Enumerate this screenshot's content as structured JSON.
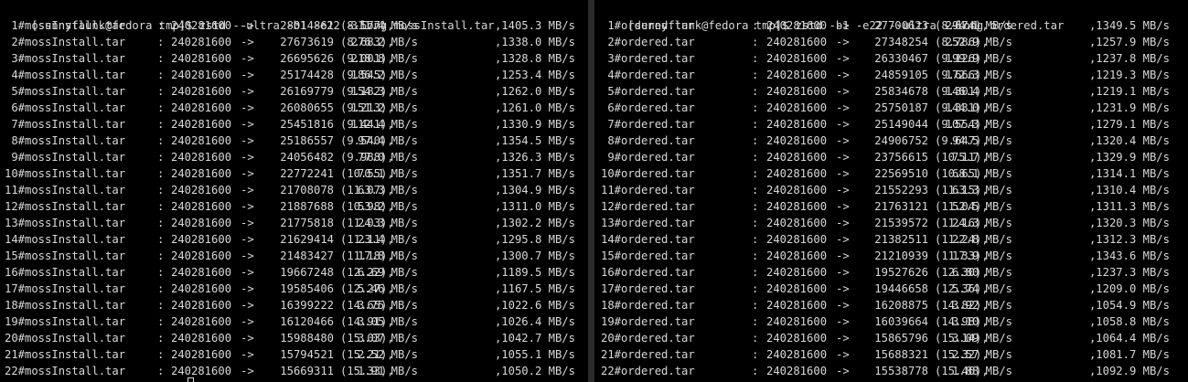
{
  "left": {
    "prompt": "[sunnyflunk@fedora tmp]$ ",
    "command": "zstd --ultra -b1 -e22 --long mossInstall.tar",
    "rows": [
      {
        "name": " 1#mossInstall.tar",
        "sep": ":",
        "in": "240281600",
        "arrow": "->",
        "out": "28014861",
        "ratio": "(8.577),",
        "comp": "311.4 MB/s",
        "decomp": ",1405.3 MB/s"
      },
      {
        "name": " 2#mossInstall.tar",
        "sep": ":",
        "in": "240281600",
        "arrow": "->",
        "out": "27673619",
        "ratio": "(8.683),",
        "comp": "276.2 MB/s",
        "decomp": ",1338.0 MB/s"
      },
      {
        "name": " 3#mossInstall.tar",
        "sep": ":",
        "in": "240281600",
        "arrow": "->",
        "out": "26695626",
        "ratio": "(9.001),",
        "comp": "218.8 MB/s",
        "decomp": ",1328.8 MB/s"
      },
      {
        "name": " 4#mossInstall.tar",
        "sep": ":",
        "in": "240281600",
        "arrow": "->",
        "out": "25174428",
        "ratio": "(9.545),",
        "comp": "186.2 MB/s",
        "decomp": ",1253.4 MB/s"
      },
      {
        "name": " 5#mossInstall.tar",
        "sep": ":",
        "in": "240281600",
        "arrow": "->",
        "out": "26169779",
        "ratio": "(9.182),",
        "comp": "154.3 MB/s",
        "decomp": ",1262.0 MB/s"
      },
      {
        "name": " 6#mossInstall.tar",
        "sep": ":",
        "in": "240281600",
        "arrow": "->",
        "out": "26080655",
        "ratio": "(9.213),",
        "comp": "151.2 MB/s",
        "decomp": ",1261.0 MB/s"
      },
      {
        "name": " 7#mossInstall.tar",
        "sep": ":",
        "in": "240281600",
        "arrow": "->",
        "out": "25451816",
        "ratio": "(9.441),",
        "comp": "112.4 MB/s",
        "decomp": ",1330.9 MB/s"
      },
      {
        "name": " 8#mossInstall.tar",
        "sep": ":",
        "in": "240281600",
        "arrow": "->",
        "out": "25186557",
        "ratio": "(9.540),",
        "comp": "97.4 MB/s",
        "decomp": ",1354.5 MB/s"
      },
      {
        "name": " 9#mossInstall.tar",
        "sep": ":",
        "in": "240281600",
        "arrow": "->",
        "out": "24056482",
        "ratio": "(9.988),",
        "comp": "77.0 MB/s",
        "decomp": ",1326.3 MB/s"
      },
      {
        "name": "10#mossInstall.tar",
        "sep": ":",
        "in": "240281600",
        "arrow": "->",
        "out": "22772241",
        "ratio": "(10.55),",
        "comp": "70.1 MB/s",
        "decomp": ",1351.7 MB/s"
      },
      {
        "name": "11#mossInstall.tar",
        "sep": ":",
        "in": "240281600",
        "arrow": "->",
        "out": "21708078",
        "ratio": "(11.07),",
        "comp": "63.3 MB/s",
        "decomp": ",1304.9 MB/s"
      },
      {
        "name": "12#mossInstall.tar",
        "sep": ":",
        "in": "240281600",
        "arrow": "->",
        "out": "21887688",
        "ratio": "(10.98),",
        "comp": "53.2 MB/s",
        "decomp": ",1311.0 MB/s"
      },
      {
        "name": "13#mossInstall.tar",
        "sep": ":",
        "in": "240281600",
        "arrow": "->",
        "out": "21775818",
        "ratio": "(11.03),",
        "comp": "24.3 MB/s",
        "decomp": ",1302.2 MB/s"
      },
      {
        "name": "14#mossInstall.tar",
        "sep": ":",
        "in": "240281600",
        "arrow": "->",
        "out": "21629414",
        "ratio": "(11.11),",
        "comp": "23.4 MB/s",
        "decomp": ",1295.8 MB/s"
      },
      {
        "name": "15#mossInstall.tar",
        "sep": ":",
        "in": "240281600",
        "arrow": "->",
        "out": "21483427",
        "ratio": "(11.18),",
        "comp": "17.8 MB/s",
        "decomp": ",1300.7 MB/s"
      },
      {
        "name": "16#mossInstall.tar",
        "sep": ":",
        "in": "240281600",
        "arrow": "->",
        "out": "19667248",
        "ratio": "(12.22),",
        "comp": "6.69 MB/s",
        "decomp": ",1189.5 MB/s"
      },
      {
        "name": "17#mossInstall.tar",
        "sep": ":",
        "in": "240281600",
        "arrow": "->",
        "out": "19585406",
        "ratio": "(12.27),",
        "comp": "5.46 MB/s",
        "decomp": ",1167.5 MB/s"
      },
      {
        "name": "18#mossInstall.tar",
        "sep": ":",
        "in": "240281600",
        "arrow": "->",
        "out": "16399222",
        "ratio": "(14.65),",
        "comp": "3.75 MB/s",
        "decomp": ",1022.6 MB/s"
      },
      {
        "name": "19#mossInstall.tar",
        "sep": ":",
        "in": "240281600",
        "arrow": "->",
        "out": "16120466",
        "ratio": "(14.91),",
        "comp": "3.05 MB/s",
        "decomp": ",1026.4 MB/s"
      },
      {
        "name": "20#mossInstall.tar",
        "sep": ":",
        "in": "240281600",
        "arrow": "->",
        "out": "15988480",
        "ratio": "(15.03),",
        "comp": "3.07 MB/s",
        "decomp": ",1042.7 MB/s"
      },
      {
        "name": "21#mossInstall.tar",
        "sep": ":",
        "in": "240281600",
        "arrow": "->",
        "out": "15794521",
        "ratio": "(15.21),",
        "comp": "2.52 MB/s",
        "decomp": ",1055.1 MB/s"
      },
      {
        "name": "22#mossInstall.tar",
        "sep": ":",
        "in": "240281600",
        "arrow": "->",
        "out": "15669311",
        "ratio": "(15.33),",
        "comp": "1.91 MB/s",
        "decomp": ",1050.2 MB/s"
      }
    ]
  },
  "right": {
    "prompt": "[sunnyflunk@fedora tmp]$ ",
    "command": "zstd -b1 -e22 --ultra --long ordered.tar",
    "rows": [
      {
        "name": " 1#ordered.tar",
        "sep": ":",
        "in": "240281600",
        "arrow": "->",
        "out": "27700623",
        "ratio": "(8.674),",
        "comp": "294.1 MB/s",
        "decomp": ",1349.5 MB/s"
      },
      {
        "name": " 2#ordered.tar",
        "sep": ":",
        "in": "240281600",
        "arrow": "->",
        "out": "27348254",
        "ratio": "(8.786),",
        "comp": "252.9 MB/s",
        "decomp": ",1257.9 MB/s"
      },
      {
        "name": " 3#ordered.tar",
        "sep": ":",
        "in": "240281600",
        "arrow": "->",
        "out": "26330467",
        "ratio": "(9.126),",
        "comp": "199.9 MB/s",
        "decomp": ",1237.8 MB/s"
      },
      {
        "name": " 4#ordered.tar",
        "sep": ":",
        "in": "240281600",
        "arrow": "->",
        "out": "24859105",
        "ratio": "(9.666),",
        "comp": "172.3 MB/s",
        "decomp": ",1219.3 MB/s"
      },
      {
        "name": " 5#ordered.tar",
        "sep": ":",
        "in": "240281600",
        "arrow": "->",
        "out": "25834678",
        "ratio": "(9.301),",
        "comp": "146.4 MB/s",
        "decomp": ",1219.1 MB/s"
      },
      {
        "name": " 6#ordered.tar",
        "sep": ":",
        "in": "240281600",
        "arrow": "->",
        "out": "25750187",
        "ratio": "(9.331),",
        "comp": "144.0 MB/s",
        "decomp": ",1231.9 MB/s"
      },
      {
        "name": " 7#ordered.tar",
        "sep": ":",
        "in": "240281600",
        "arrow": "->",
        "out": "25149044",
        "ratio": "(9.554),",
        "comp": "107.3 MB/s",
        "decomp": ",1279.1 MB/s"
      },
      {
        "name": " 8#ordered.tar",
        "sep": ":",
        "in": "240281600",
        "arrow": "->",
        "out": "24906752",
        "ratio": "(9.647),",
        "comp": "94.5 MB/s",
        "decomp": ",1320.4 MB/s"
      },
      {
        "name": " 9#ordered.tar",
        "sep": ":",
        "in": "240281600",
        "arrow": "->",
        "out": "23756615",
        "ratio": "(10.11),",
        "comp": "75.7 MB/s",
        "decomp": ",1329.9 MB/s"
      },
      {
        "name": "10#ordered.tar",
        "sep": ":",
        "in": "240281600",
        "arrow": "->",
        "out": "22569510",
        "ratio": "(10.65),",
        "comp": "68.1 MB/s",
        "decomp": ",1314.1 MB/s"
      },
      {
        "name": "11#ordered.tar",
        "sep": ":",
        "in": "240281600",
        "arrow": "->",
        "out": "21552293",
        "ratio": "(11.15),",
        "comp": "63.3 MB/s",
        "decomp": ",1310.4 MB/s"
      },
      {
        "name": "12#ordered.tar",
        "sep": ":",
        "in": "240281600",
        "arrow": "->",
        "out": "21763121",
        "ratio": "(11.04),",
        "comp": "52.5 MB/s",
        "decomp": ",1311.3 MB/s"
      },
      {
        "name": "13#ordered.tar",
        "sep": ":",
        "in": "240281600",
        "arrow": "->",
        "out": "21539572",
        "ratio": "(11.16),",
        "comp": "24.3 MB/s",
        "decomp": ",1320.3 MB/s"
      },
      {
        "name": "14#ordered.tar",
        "sep": ":",
        "in": "240281600",
        "arrow": "->",
        "out": "21382511",
        "ratio": "(11.24),",
        "comp": "22.8 MB/s",
        "decomp": ",1312.3 MB/s"
      },
      {
        "name": "15#ordered.tar",
        "sep": ":",
        "in": "240281600",
        "arrow": "->",
        "out": "21210939",
        "ratio": "(11.33),",
        "comp": "17.9 MB/s",
        "decomp": ",1343.6 MB/s"
      },
      {
        "name": "16#ordered.tar",
        "sep": ":",
        "in": "240281600",
        "arrow": "->",
        "out": "19527626",
        "ratio": "(12.30),",
        "comp": "6.80 MB/s",
        "decomp": ",1237.3 MB/s"
      },
      {
        "name": "17#ordered.tar",
        "sep": ":",
        "in": "240281600",
        "arrow": "->",
        "out": "19446658",
        "ratio": "(12.36),",
        "comp": "5.74 MB/s",
        "decomp": ",1209.0 MB/s"
      },
      {
        "name": "18#ordered.tar",
        "sep": ":",
        "in": "240281600",
        "arrow": "->",
        "out": "16208875",
        "ratio": "(14.82),",
        "comp": "3.92 MB/s",
        "decomp": ",1054.9 MB/s"
      },
      {
        "name": "19#ordered.tar",
        "sep": ":",
        "in": "240281600",
        "arrow": "->",
        "out": "16039664",
        "ratio": "(14.98),",
        "comp": "3.10 MB/s",
        "decomp": ",1058.8 MB/s"
      },
      {
        "name": "20#ordered.tar",
        "sep": ":",
        "in": "240281600",
        "arrow": "->",
        "out": "15865796",
        "ratio": "(15.14),",
        "comp": "3.09 MB/s",
        "decomp": ",1064.4 MB/s"
      },
      {
        "name": "21#ordered.tar",
        "sep": ":",
        "in": "240281600",
        "arrow": "->",
        "out": "15688321",
        "ratio": "(15.32),",
        "comp": "2.57 MB/s",
        "decomp": ",1081.7 MB/s"
      },
      {
        "name": "22#ordered.tar",
        "sep": ":",
        "in": "240281600",
        "arrow": "->",
        "out": "15538778",
        "ratio": "(15.46),",
        "comp": "1.88 MB/s",
        "decomp": ",1092.9 MB/s"
      }
    ]
  },
  "colors": {
    "background": "#000000",
    "text": "#d8d8d8",
    "divider": "#2a2a2a"
  }
}
